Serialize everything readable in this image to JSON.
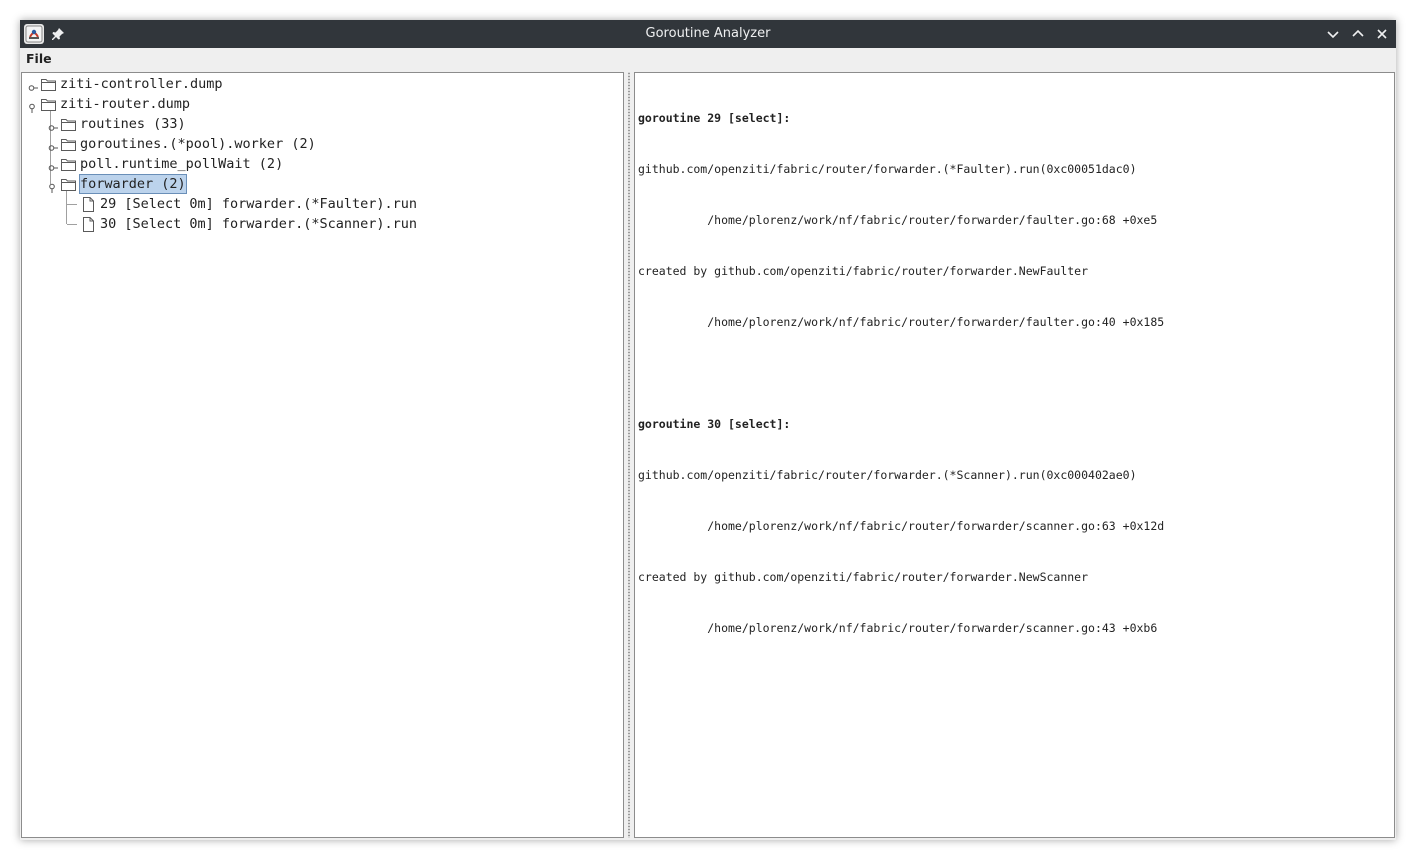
{
  "window": {
    "title": "Goroutine Analyzer"
  },
  "menu": {
    "file": "File"
  },
  "tree": {
    "items": [
      {
        "label": "ziti-controller.dump",
        "type": "folder",
        "depth": 0,
        "expanded": false
      },
      {
        "label": "ziti-router.dump",
        "type": "folder",
        "depth": 0,
        "expanded": true
      },
      {
        "label": "routines (33)",
        "type": "folder",
        "depth": 1,
        "expanded": false
      },
      {
        "label": "goroutines.(*pool).worker (2)",
        "type": "folder",
        "depth": 1,
        "expanded": false
      },
      {
        "label": "poll.runtime_pollWait (2)",
        "type": "folder",
        "depth": 1,
        "expanded": false
      },
      {
        "label": "forwarder (2)",
        "type": "folder",
        "depth": 1,
        "expanded": true,
        "selected": true
      },
      {
        "label": "29 [Select 0m] forwarder.(*Faulter).run",
        "type": "file",
        "depth": 2
      },
      {
        "label": "30 [Select 0m] forwarder.(*Scanner).run",
        "type": "file",
        "depth": 2
      }
    ]
  },
  "details": {
    "blocks": [
      {
        "header": "goroutine 29 [select]:",
        "lines": [
          "github.com/openziti/fabric/router/forwarder.(*Faulter).run(0xc00051dac0)",
          "          /home/plorenz/work/nf/fabric/router/forwarder/faulter.go:68 +0xe5",
          "created by github.com/openziti/fabric/router/forwarder.NewFaulter",
          "          /home/plorenz/work/nf/fabric/router/forwarder/faulter.go:40 +0x185"
        ]
      },
      {
        "header": "goroutine 30 [select]:",
        "lines": [
          "github.com/openziti/fabric/router/forwarder.(*Scanner).run(0xc000402ae0)",
          "          /home/plorenz/work/nf/fabric/router/forwarder/scanner.go:63 +0x12d",
          "created by github.com/openziti/fabric/router/forwarder.NewScanner",
          "          /home/plorenz/work/nf/fabric/router/forwarder/scanner.go:43 +0xb6"
        ]
      }
    ]
  },
  "colors": {
    "titlebar": "#31363b",
    "selection": "#bcd3ec"
  }
}
